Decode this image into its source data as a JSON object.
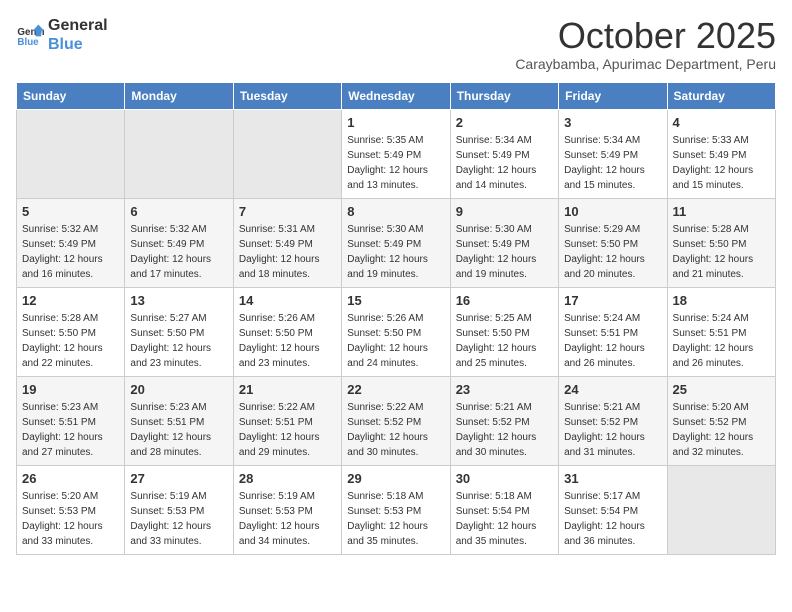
{
  "header": {
    "logo_line1": "General",
    "logo_line2": "Blue",
    "title": "October 2025",
    "subtitle": "Caraybamba, Apurimac Department, Peru"
  },
  "days_of_week": [
    "Sunday",
    "Monday",
    "Tuesday",
    "Wednesday",
    "Thursday",
    "Friday",
    "Saturday"
  ],
  "weeks": [
    [
      {
        "day": "",
        "info": ""
      },
      {
        "day": "",
        "info": ""
      },
      {
        "day": "",
        "info": ""
      },
      {
        "day": "1",
        "info": "Sunrise: 5:35 AM\nSunset: 5:49 PM\nDaylight: 12 hours\nand 13 minutes."
      },
      {
        "day": "2",
        "info": "Sunrise: 5:34 AM\nSunset: 5:49 PM\nDaylight: 12 hours\nand 14 minutes."
      },
      {
        "day": "3",
        "info": "Sunrise: 5:34 AM\nSunset: 5:49 PM\nDaylight: 12 hours\nand 15 minutes."
      },
      {
        "day": "4",
        "info": "Sunrise: 5:33 AM\nSunset: 5:49 PM\nDaylight: 12 hours\nand 15 minutes."
      }
    ],
    [
      {
        "day": "5",
        "info": "Sunrise: 5:32 AM\nSunset: 5:49 PM\nDaylight: 12 hours\nand 16 minutes."
      },
      {
        "day": "6",
        "info": "Sunrise: 5:32 AM\nSunset: 5:49 PM\nDaylight: 12 hours\nand 17 minutes."
      },
      {
        "day": "7",
        "info": "Sunrise: 5:31 AM\nSunset: 5:49 PM\nDaylight: 12 hours\nand 18 minutes."
      },
      {
        "day": "8",
        "info": "Sunrise: 5:30 AM\nSunset: 5:49 PM\nDaylight: 12 hours\nand 19 minutes."
      },
      {
        "day": "9",
        "info": "Sunrise: 5:30 AM\nSunset: 5:49 PM\nDaylight: 12 hours\nand 19 minutes."
      },
      {
        "day": "10",
        "info": "Sunrise: 5:29 AM\nSunset: 5:50 PM\nDaylight: 12 hours\nand 20 minutes."
      },
      {
        "day": "11",
        "info": "Sunrise: 5:28 AM\nSunset: 5:50 PM\nDaylight: 12 hours\nand 21 minutes."
      }
    ],
    [
      {
        "day": "12",
        "info": "Sunrise: 5:28 AM\nSunset: 5:50 PM\nDaylight: 12 hours\nand 22 minutes."
      },
      {
        "day": "13",
        "info": "Sunrise: 5:27 AM\nSunset: 5:50 PM\nDaylight: 12 hours\nand 23 minutes."
      },
      {
        "day": "14",
        "info": "Sunrise: 5:26 AM\nSunset: 5:50 PM\nDaylight: 12 hours\nand 23 minutes."
      },
      {
        "day": "15",
        "info": "Sunrise: 5:26 AM\nSunset: 5:50 PM\nDaylight: 12 hours\nand 24 minutes."
      },
      {
        "day": "16",
        "info": "Sunrise: 5:25 AM\nSunset: 5:50 PM\nDaylight: 12 hours\nand 25 minutes."
      },
      {
        "day": "17",
        "info": "Sunrise: 5:24 AM\nSunset: 5:51 PM\nDaylight: 12 hours\nand 26 minutes."
      },
      {
        "day": "18",
        "info": "Sunrise: 5:24 AM\nSunset: 5:51 PM\nDaylight: 12 hours\nand 26 minutes."
      }
    ],
    [
      {
        "day": "19",
        "info": "Sunrise: 5:23 AM\nSunset: 5:51 PM\nDaylight: 12 hours\nand 27 minutes."
      },
      {
        "day": "20",
        "info": "Sunrise: 5:23 AM\nSunset: 5:51 PM\nDaylight: 12 hours\nand 28 minutes."
      },
      {
        "day": "21",
        "info": "Sunrise: 5:22 AM\nSunset: 5:51 PM\nDaylight: 12 hours\nand 29 minutes."
      },
      {
        "day": "22",
        "info": "Sunrise: 5:22 AM\nSunset: 5:52 PM\nDaylight: 12 hours\nand 30 minutes."
      },
      {
        "day": "23",
        "info": "Sunrise: 5:21 AM\nSunset: 5:52 PM\nDaylight: 12 hours\nand 30 minutes."
      },
      {
        "day": "24",
        "info": "Sunrise: 5:21 AM\nSunset: 5:52 PM\nDaylight: 12 hours\nand 31 minutes."
      },
      {
        "day": "25",
        "info": "Sunrise: 5:20 AM\nSunset: 5:52 PM\nDaylight: 12 hours\nand 32 minutes."
      }
    ],
    [
      {
        "day": "26",
        "info": "Sunrise: 5:20 AM\nSunset: 5:53 PM\nDaylight: 12 hours\nand 33 minutes."
      },
      {
        "day": "27",
        "info": "Sunrise: 5:19 AM\nSunset: 5:53 PM\nDaylight: 12 hours\nand 33 minutes."
      },
      {
        "day": "28",
        "info": "Sunrise: 5:19 AM\nSunset: 5:53 PM\nDaylight: 12 hours\nand 34 minutes."
      },
      {
        "day": "29",
        "info": "Sunrise: 5:18 AM\nSunset: 5:53 PM\nDaylight: 12 hours\nand 35 minutes."
      },
      {
        "day": "30",
        "info": "Sunrise: 5:18 AM\nSunset: 5:54 PM\nDaylight: 12 hours\nand 35 minutes."
      },
      {
        "day": "31",
        "info": "Sunrise: 5:17 AM\nSunset: 5:54 PM\nDaylight: 12 hours\nand 36 minutes."
      },
      {
        "day": "",
        "info": ""
      }
    ]
  ]
}
